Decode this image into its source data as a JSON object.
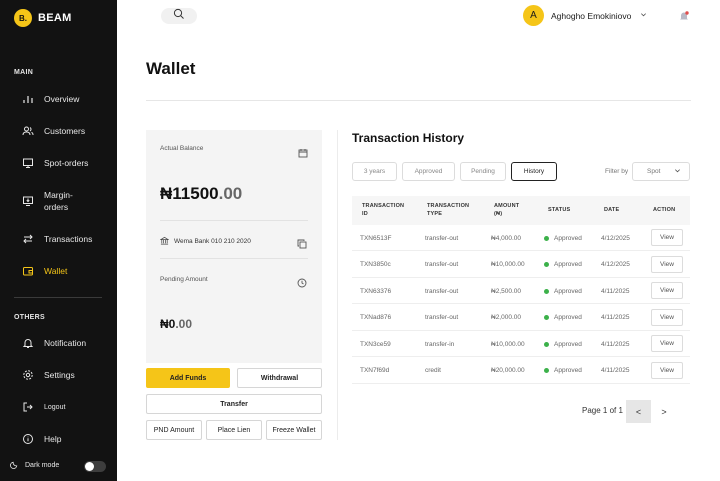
{
  "brand": {
    "logo": "B.",
    "name": "BEAM"
  },
  "sidebar": {
    "main_label": "MAIN",
    "main_items": [
      {
        "label": "Overview",
        "icon": "bar-chart-icon"
      },
      {
        "label": "Customers",
        "icon": "users-icon"
      },
      {
        "label": "Spot-orders",
        "icon": "monitor-icon"
      },
      {
        "label": "Margin-orders",
        "icon": "desktop-download-icon"
      },
      {
        "label": "Transactions",
        "icon": "transfer-arrows-icon"
      },
      {
        "label": "Wallet",
        "icon": "wallet-icon",
        "active": true
      }
    ],
    "others_label": "OTHERS",
    "other_items": [
      {
        "label": "Notification",
        "icon": "bell-icon"
      },
      {
        "label": "Settings",
        "icon": "gear-icon"
      },
      {
        "label": "Logout",
        "icon": "logout-icon"
      },
      {
        "label": "Help",
        "icon": "info-icon"
      }
    ],
    "dark_mode_label": "Dark mode",
    "dark_mode_on": false
  },
  "header": {
    "user_initial": "A",
    "user_name": "Aghogho Emokiniovo",
    "accent": "#f5c518"
  },
  "page": {
    "title": "Wallet"
  },
  "balance": {
    "actual_label": "Actual Balance",
    "actual_whole": "₦11500",
    "actual_decimal": ".00",
    "bank_text": "Wema Bank 010 210 2020",
    "pending_label": "Pending Amount",
    "pending_whole": "₦0",
    "pending_decimal": ".00"
  },
  "actions": {
    "add_funds": "Add Funds",
    "withdrawal": "Withdrawal",
    "transfer": "Transfer",
    "pnd_amount": "PND Amount",
    "place_lien": "Place Lien",
    "freeze_wallet": "Freeze Wallet"
  },
  "history": {
    "title": "Transaction History",
    "tabs": [
      {
        "label": "3 years",
        "active": false
      },
      {
        "label": "Approved",
        "active": false
      },
      {
        "label": "Pending",
        "active": false
      },
      {
        "label": "History",
        "active": true
      }
    ],
    "filter_label": "Filter by",
    "filter_value": "Spot",
    "columns": {
      "id_1": "TRANSACTION",
      "id_2": "ID",
      "type_1": "TRANSACTION",
      "type_2": "TYPE",
      "amount_1": "AMOUNT",
      "amount_2": "(₦)",
      "status": "STATUS",
      "date": "DATE",
      "action": "ACTION"
    },
    "rows": [
      {
        "id": "TXN6513F",
        "type": "transfer-out",
        "amount": "₦4,000.00",
        "status": "Approved",
        "date": "4/12/2025",
        "action": "View"
      },
      {
        "id": "TXN3850c",
        "type": "transfer-out",
        "amount": "₦10,000.00",
        "status": "Approved",
        "date": "4/12/2025",
        "action": "View"
      },
      {
        "id": "TXN63376",
        "type": "transfer-out",
        "amount": "₦2,500.00",
        "status": "Approved",
        "date": "4/11/2025",
        "action": "View"
      },
      {
        "id": "TXNad876",
        "type": "transfer-out",
        "amount": "₦2,000.00",
        "status": "Approved",
        "date": "4/11/2025",
        "action": "View"
      },
      {
        "id": "TXN3ce59",
        "type": "transfer-in",
        "amount": "₦10,000.00",
        "status": "Approved",
        "date": "4/11/2025",
        "action": "View"
      },
      {
        "id": "TXN7f69d",
        "type": "credit",
        "amount": "₦20,000.00",
        "status": "Approved",
        "date": "4/11/2025",
        "action": "View"
      }
    ],
    "status_color": "#3cb14a",
    "pager_label": "Page 1 of 1",
    "prev": "<",
    "next": ">"
  }
}
